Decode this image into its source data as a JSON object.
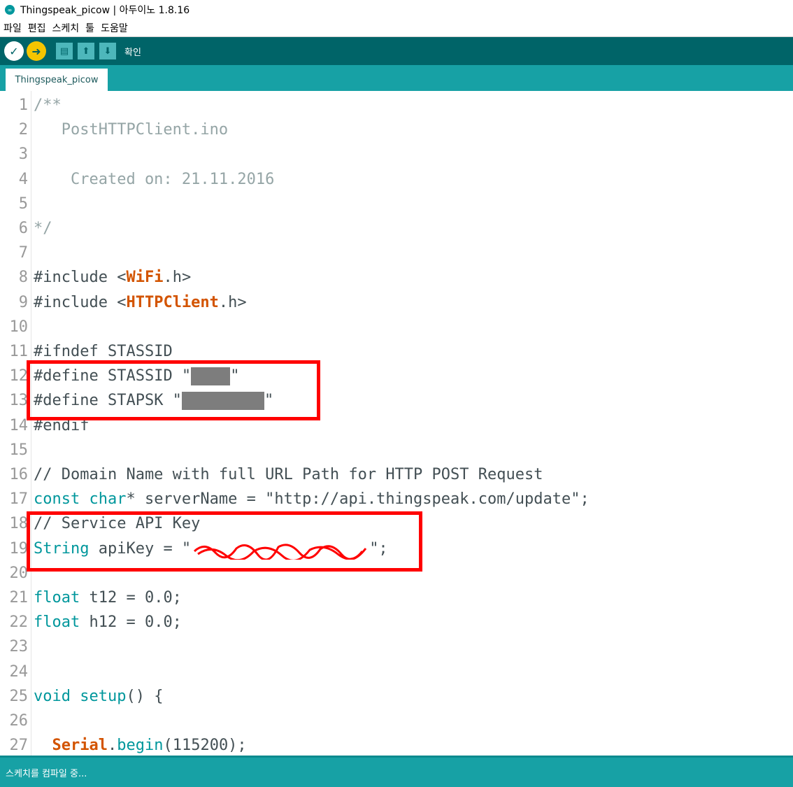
{
  "window": {
    "title": "Thingspeak_picow | 아두이노 1.8.16"
  },
  "menu": [
    "파일",
    "편집",
    "스케치",
    "툴",
    "도움말"
  ],
  "toolbar": {
    "status_label": "확인"
  },
  "tab": {
    "name": "Thingspeak_picow"
  },
  "colors": {
    "toolbar_bg": "#006468",
    "tabbar_bg": "#17a1a5",
    "keyword": "#d35400",
    "type": "#00979c",
    "comment": "#95a5a6",
    "text": "#434f54",
    "highlight": "#ff0000"
  },
  "code_lines": [
    {
      "n": "1",
      "tokens": [
        {
          "t": "/**",
          "c": "comment"
        }
      ]
    },
    {
      "n": "2",
      "tokens": [
        {
          "t": "   PostHTTPClient.ino",
          "c": "comment"
        }
      ]
    },
    {
      "n": "3",
      "tokens": []
    },
    {
      "n": "4",
      "tokens": [
        {
          "t": "    Created on: 21.11.2016",
          "c": "comment"
        }
      ]
    },
    {
      "n": "5",
      "tokens": []
    },
    {
      "n": "6",
      "tokens": [
        {
          "t": "*/",
          "c": "comment"
        }
      ]
    },
    {
      "n": "7",
      "tokens": []
    },
    {
      "n": "8",
      "tokens": [
        {
          "t": "#include ",
          "c": "pre"
        },
        {
          "t": "<",
          "c": "text"
        },
        {
          "t": "WiFi",
          "c": "kw"
        },
        {
          "t": ".h>",
          "c": "text"
        }
      ]
    },
    {
      "n": "9",
      "tokens": [
        {
          "t": "#include ",
          "c": "pre"
        },
        {
          "t": "<",
          "c": "text"
        },
        {
          "t": "HTTPClient",
          "c": "kw"
        },
        {
          "t": ".h>",
          "c": "text"
        }
      ]
    },
    {
      "n": "10",
      "tokens": []
    },
    {
      "n": "11",
      "tokens": [
        {
          "t": "#ifndef ",
          "c": "pre"
        },
        {
          "t": "STASSID",
          "c": "text"
        }
      ]
    },
    {
      "n": "12",
      "tokens": [
        {
          "t": "#define ",
          "c": "pre"
        },
        {
          "t": "STASSID \"",
          "c": "text"
        },
        {
          "t": "",
          "c": "redact",
          "w": 56
        },
        {
          "t": "\"",
          "c": "text"
        }
      ]
    },
    {
      "n": "13",
      "tokens": [
        {
          "t": "#define ",
          "c": "pre"
        },
        {
          "t": "STAPSK \"",
          "c": "text"
        },
        {
          "t": "",
          "c": "redact",
          "w": 118
        },
        {
          "t": "\"",
          "c": "text"
        }
      ]
    },
    {
      "n": "14",
      "tokens": [
        {
          "t": "#endif",
          "c": "pre"
        }
      ]
    },
    {
      "n": "15",
      "tokens": []
    },
    {
      "n": "16",
      "tokens": [
        {
          "t": "// Domain Name with full URL Path for HTTP POST Request",
          "c": "text"
        }
      ]
    },
    {
      "n": "17",
      "tokens": [
        {
          "t": "const char",
          "c": "type"
        },
        {
          "t": "* serverName = \"http://api.thingspeak.com/update\";",
          "c": "text"
        }
      ]
    },
    {
      "n": "18",
      "tokens": [
        {
          "t": "// Service API Key",
          "c": "text"
        }
      ]
    },
    {
      "n": "19",
      "tokens": [
        {
          "t": "String",
          "c": "type"
        },
        {
          "t": " apiKey = \"",
          "c": "text"
        },
        {
          "t": "",
          "c": "scribble"
        },
        {
          "t": "\";",
          "c": "text"
        }
      ]
    },
    {
      "n": "20",
      "tokens": []
    },
    {
      "n": "21",
      "tokens": [
        {
          "t": "float",
          "c": "type"
        },
        {
          "t": " t12 = 0.0;",
          "c": "text"
        }
      ]
    },
    {
      "n": "22",
      "tokens": [
        {
          "t": "float",
          "c": "type"
        },
        {
          "t": " h12 = 0.0;",
          "c": "text"
        }
      ]
    },
    {
      "n": "23",
      "tokens": []
    },
    {
      "n": "24",
      "tokens": []
    },
    {
      "n": "25",
      "tokens": [
        {
          "t": "void",
          "c": "type"
        },
        {
          "t": " ",
          "c": "text"
        },
        {
          "t": "setup",
          "c": "type"
        },
        {
          "t": "() {",
          "c": "text"
        }
      ]
    },
    {
      "n": "26",
      "tokens": []
    },
    {
      "n": "27",
      "tokens": [
        {
          "t": "  ",
          "c": "text"
        },
        {
          "t": "Serial",
          "c": "kw"
        },
        {
          "t": ".",
          "c": "text"
        },
        {
          "t": "begin",
          "c": "type"
        },
        {
          "t": "(115200);",
          "c": "text"
        }
      ]
    }
  ],
  "status": {
    "message": "스케치를 컴파일 중..."
  }
}
